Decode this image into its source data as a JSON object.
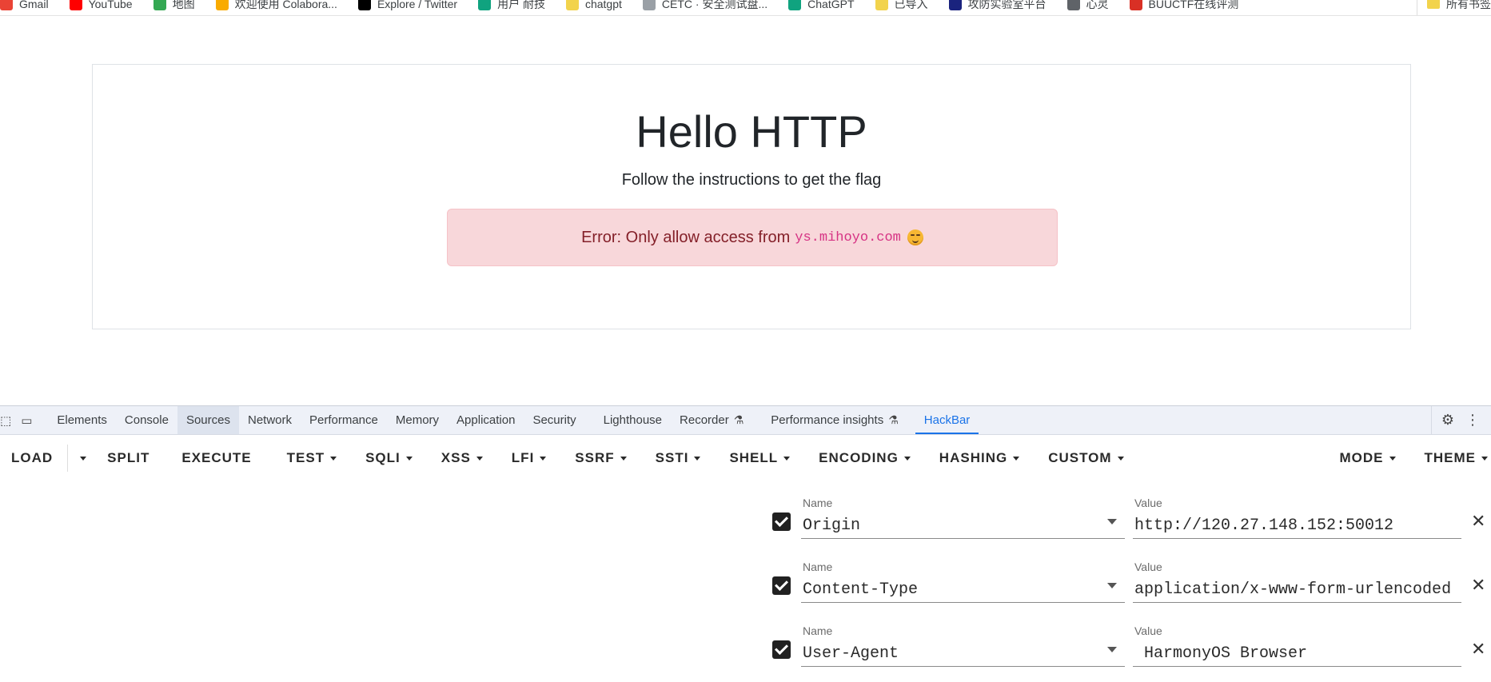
{
  "bookmarks": [
    {
      "label": "Gmail",
      "color": "#ea4335"
    },
    {
      "label": "YouTube",
      "color": "#ff0000"
    },
    {
      "label": "地图",
      "color": "#34a853"
    },
    {
      "label": "欢迎使用 Colabora...",
      "color": "#f9ab00"
    },
    {
      "label": "Explore / Twitter",
      "color": "#000000"
    },
    {
      "label": "用户 耐技",
      "color": "#10a37f"
    },
    {
      "label": "chatgpt",
      "color": "#f2d34c"
    },
    {
      "label": "CETC · 安全测试盘...",
      "color": "#9aa0a6"
    },
    {
      "label": "ChatGPT",
      "color": "#10a37f"
    },
    {
      "label": "已导入",
      "color": "#f2d34c"
    },
    {
      "label": "攻防实验室平台",
      "color": "#1a237e"
    },
    {
      "label": "心灵",
      "color": "#5f6368"
    },
    {
      "label": "BUUCTF在线评测",
      "color": "#d93025"
    }
  ],
  "bookmarks_right": "所有书签",
  "page": {
    "title": "Hello HTTP",
    "subtitle": "Follow the instructions to get the flag",
    "alert_text": "Error: Only allow access from",
    "alert_code": "ys.mihoyo.com"
  },
  "devtools": {
    "tabs": [
      {
        "label": "Elements"
      },
      {
        "label": "Console"
      },
      {
        "label": "Sources",
        "selected": true
      },
      {
        "label": "Network"
      },
      {
        "label": "Performance"
      },
      {
        "label": "Memory"
      },
      {
        "label": "Application"
      },
      {
        "label": "Security"
      },
      {
        "label": "Lighthouse"
      },
      {
        "label": "Recorder",
        "flask": true
      },
      {
        "label": "Performance insights",
        "flask": true
      },
      {
        "label": "HackBar",
        "active": true
      }
    ]
  },
  "hackbar": {
    "load": "LOAD",
    "buttons": [
      "SPLIT",
      "EXECUTE"
    ],
    "menus": [
      "TEST",
      "SQLI",
      "XSS",
      "LFI",
      "SSRF",
      "SSTI",
      "SHELL",
      "ENCODING",
      "HASHING",
      "CUSTOM"
    ],
    "right_menus": [
      "MODE",
      "THEME"
    ],
    "headers": [
      {
        "name_label": "Name",
        "name": "Origin",
        "value_label": "Value",
        "value": "http://120.27.148.152:50012"
      },
      {
        "name_label": "Name",
        "name": "Content-Type",
        "value_label": "Value",
        "value": "application/x-www-form-urlencoded"
      },
      {
        "name_label": "Name",
        "name": "User-Agent",
        "value_label": "Value",
        "value": " HarmonyOS Browser"
      }
    ]
  }
}
